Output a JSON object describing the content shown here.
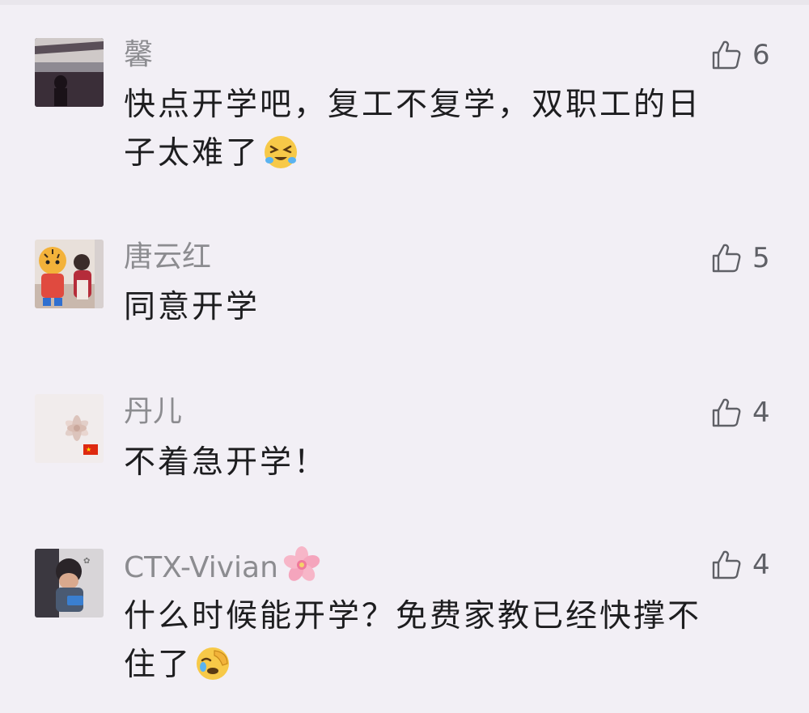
{
  "comments": [
    {
      "name": "馨",
      "text_line1": "快点开学吧，复工不复学，双职工的日",
      "text_line2": "子太难了",
      "likes": "6",
      "emoji": "crying-laughing-emoji"
    },
    {
      "name": "唐云红",
      "text_line1": "同意开学",
      "likes": "5"
    },
    {
      "name": "丹儿",
      "text_line1": "不着急开学！",
      "likes": "4"
    },
    {
      "name": "CTX-Vivian",
      "name_emoji": "cherry-blossom-emoji",
      "text_line1": "什么时候能开学？免费家教已经快撑不",
      "text_line2": "住了",
      "likes": "4",
      "emoji": "facepalm-crying-emoji"
    }
  ],
  "colors": {
    "background": "#f2eff5",
    "name": "#8c8c90",
    "text": "#1d1d1f",
    "like_icon": "#5f6066"
  }
}
